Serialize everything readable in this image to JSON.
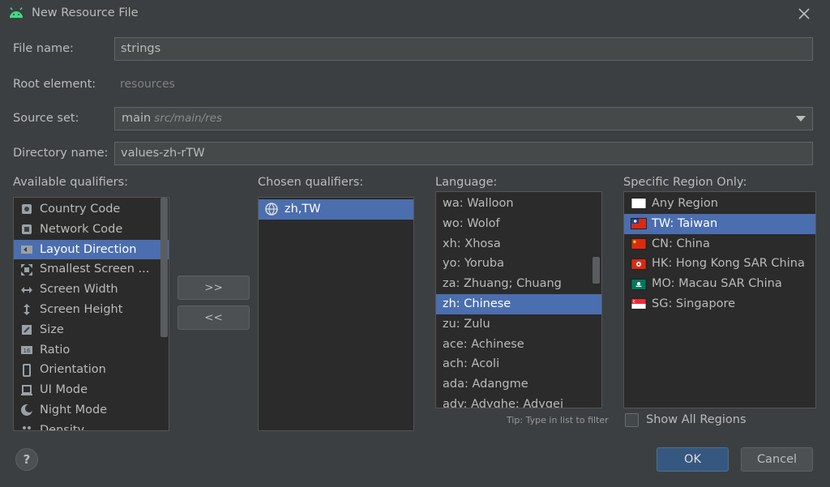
{
  "window": {
    "title": "New Resource File"
  },
  "form": {
    "file_name_label": "File name:",
    "file_name_value": "strings",
    "root_element_label": "Root element:",
    "root_element_value": "resources",
    "source_set_label": "Source set:",
    "source_set_value": "main",
    "source_set_hint": "src/main/res",
    "directory_name_label": "Directory name:",
    "directory_name_value": "values-zh-rTW"
  },
  "available_qualifiers": {
    "label": "Available qualifiers:",
    "items": [
      {
        "label": "Country Code",
        "icon": "country-code-icon"
      },
      {
        "label": "Network Code",
        "icon": "network-code-icon"
      },
      {
        "label": "Layout Direction",
        "icon": "layout-direction-icon",
        "selected": true
      },
      {
        "label": "Smallest Screen ...",
        "icon": "smallest-screen-icon"
      },
      {
        "label": "Screen Width",
        "icon": "screen-width-icon"
      },
      {
        "label": "Screen Height",
        "icon": "screen-height-icon"
      },
      {
        "label": "Size",
        "icon": "size-icon"
      },
      {
        "label": "Ratio",
        "icon": "ratio-icon"
      },
      {
        "label": "Orientation",
        "icon": "orientation-icon"
      },
      {
        "label": "UI Mode",
        "icon": "ui-mode-icon"
      },
      {
        "label": "Night Mode",
        "icon": "night-mode-icon"
      },
      {
        "label": "Density",
        "icon": "density-icon"
      }
    ]
  },
  "transfer": {
    "add_label": ">>",
    "remove_label": "<<"
  },
  "chosen_qualifiers": {
    "label": "Chosen qualifiers:",
    "items": [
      {
        "label": "zh,TW",
        "icon": "globe-icon"
      }
    ]
  },
  "language": {
    "label": "Language:",
    "items": [
      "wa: Walloon",
      "wo: Wolof",
      "xh: Xhosa",
      "yo: Yoruba",
      "za: Zhuang; Chuang",
      "zh: Chinese",
      "zu: Zulu",
      "ace: Achinese",
      "ach: Acoli",
      "ada: Adangme",
      "ady: Adyghe; Adygei"
    ],
    "selected": "zh: Chinese",
    "tip": "Tip: Type in list to filter"
  },
  "region": {
    "label": "Specific Region Only:",
    "items": [
      {
        "label": "Any Region",
        "flag": "blank"
      },
      {
        "label": "TW: Taiwan",
        "flag": "tw",
        "selected": true
      },
      {
        "label": "CN: China",
        "flag": "cn"
      },
      {
        "label": "HK: Hong Kong SAR China",
        "flag": "hk"
      },
      {
        "label": "MO: Macau SAR China",
        "flag": "mo"
      },
      {
        "label": "SG: Singapore",
        "flag": "sg"
      }
    ],
    "show_all_label": "Show All Regions",
    "show_all_checked": false
  },
  "footer": {
    "help_label": "?",
    "ok_label": "OK",
    "cancel_label": "Cancel"
  },
  "colors": {
    "background": "#3c3f41",
    "selection": "#4b6eaf",
    "primary_button": "#365880"
  }
}
